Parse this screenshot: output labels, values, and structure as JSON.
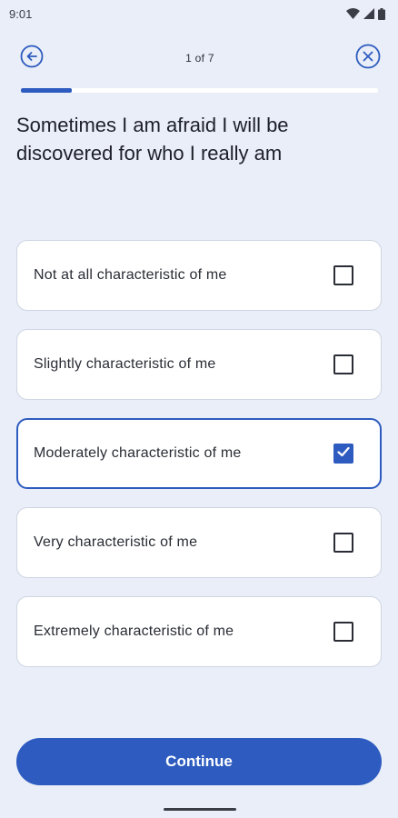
{
  "status_bar": {
    "time": "9:01"
  },
  "header": {
    "page_indicator": "1 of 7"
  },
  "progress": {
    "fraction": 0.1429
  },
  "question": {
    "text": "Sometimes I am afraid I will be discovered for who I really am"
  },
  "options": [
    {
      "label": "Not at all characteristic of me",
      "checked": false
    },
    {
      "label": "Slightly characteristic of me",
      "checked": false
    },
    {
      "label": "Moderately characteristic of me",
      "checked": true
    },
    {
      "label": "Very characteristic of me",
      "checked": false
    },
    {
      "label": "Extremely characteristic of me",
      "checked": false
    }
  ],
  "continue_button": {
    "label": "Continue"
  },
  "colors": {
    "accent": "#2d5bbf",
    "background": "#e9eef8",
    "card": "#ffffff"
  },
  "icons": {
    "back": "arrow-left-circle-icon",
    "close": "close-circle-icon"
  }
}
